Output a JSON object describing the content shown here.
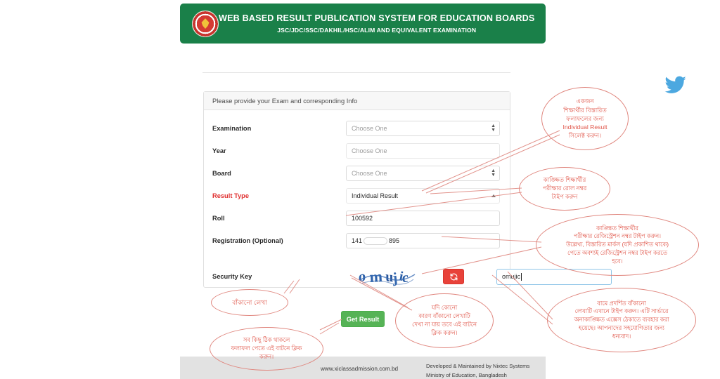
{
  "banner": {
    "logo_icon": "bangladesh-education-board-seal",
    "title": "WEB BASED RESULT PUBLICATION SYSTEM FOR EDUCATION BOARDS",
    "subtitle": "JSC/JDC/SSC/DAKHIL/HSC/ALIM AND EQUIVALENT EXAMINATION",
    "bg_color": "#1a8049"
  },
  "form": {
    "panel_heading": "Please provide your Exam and corresponding Info",
    "fields": {
      "examination": {
        "label": "Examination",
        "value": "",
        "placeholder": "Choose One",
        "type": "select"
      },
      "year": {
        "label": "Year",
        "value": "",
        "placeholder": "Choose One",
        "type": "select"
      },
      "board": {
        "label": "Board",
        "value": "",
        "placeholder": "Choose One",
        "type": "select"
      },
      "result_type": {
        "label": "Result Type",
        "value": "Individual Result",
        "placeholder": "Choose One",
        "type": "select",
        "label_color": "#e03131"
      },
      "roll": {
        "label": "Roll",
        "value": "100592",
        "placeholder": "",
        "type": "text"
      },
      "registration": {
        "label": "Registration (Optional)",
        "value_prefix": "141",
        "value_suffix": "895",
        "placeholder": "",
        "type": "text"
      },
      "security_key": {
        "label": "Security Key",
        "captcha_text": "omujic",
        "value": "omujic",
        "placeholder": "",
        "type": "text"
      }
    },
    "refresh_button": {
      "icon": "refresh-icon",
      "label": "",
      "color": "#e8423a"
    },
    "submit_button": {
      "label": "Get Result",
      "color": "#56b356"
    }
  },
  "footer": {
    "website": "www.xiclassadmission.com.bd",
    "developed_by": "Developed & Maintained by Nixtec Systems",
    "ministry": "Ministry of Education, Bangladesh"
  },
  "social": {
    "twitter_icon": "twitter-bird-icon",
    "color": "#4ca8e0"
  },
  "annotations": [
    {
      "id": "result-type-note",
      "lines": [
        "একজন",
        "শিক্ষার্থীর বিস্তারিত",
        "ফলাফলের জন্য",
        "Individual Result",
        "সিলেক্ট করুন।"
      ]
    },
    {
      "id": "roll-note",
      "lines": [
        "কাঙ্ক্ষিত শিক্ষার্থীর",
        "পরীক্ষার রোল নম্বর",
        "টাইপ করুন"
      ]
    },
    {
      "id": "registration-note",
      "lines": [
        "কাঙ্ক্ষিত শিক্ষার্থীর",
        "পরীক্ষার রেজিস্ট্রেশন নম্বর টাইপ করুন।",
        "উল্লেখ্য, বিস্তারিত মার্কস (যদি প্রকাশিত থাকে)",
        "পেতে অবশ্যই রেজিস্ট্রেশন নম্বর টাইপ করতে",
        "হবে।"
      ]
    },
    {
      "id": "security-key-input-note",
      "lines": [
        "বামে প্রদর্শিত বাঁকানো",
        "লেখাটি এখানে টাইপ করুন। এটি সার্ভারে",
        "অনাকাঙ্ক্ষিত এক্সেস ঠেকাতে ব্যবহার করা",
        "হয়েছে। আপনাদের সহযোগিতার জন্য",
        "ধন্যবাদ।"
      ]
    },
    {
      "id": "captcha-note",
      "lines": [
        "বাঁকানো লেখা"
      ]
    },
    {
      "id": "submit-note",
      "lines": [
        "সব কিছু ঠিক থাকলে",
        "ফলাফল পেতে এই   বাটনে ক্লিক",
        "করুন।"
      ]
    },
    {
      "id": "refresh-note",
      "lines": [
        "যদি কোনো",
        "কারণ বাঁকানো লেখাটি",
        "দেখা না যায় তবে এই বাটনে",
        "ক্লিক করুন।"
      ]
    }
  ]
}
